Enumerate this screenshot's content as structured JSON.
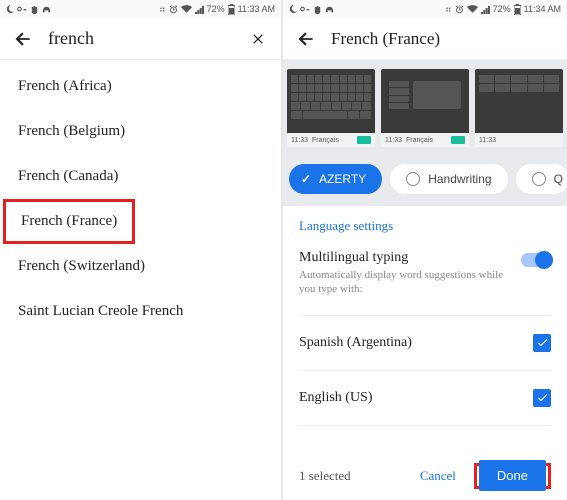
{
  "left": {
    "status": {
      "battery": "72%",
      "time": "11:33 AM"
    },
    "search_value": "french",
    "results": [
      "French (Africa)",
      "French (Belgium)",
      "French (Canada)",
      "French (France)",
      "French (Switzerland)",
      "Saint Lucian Creole French"
    ],
    "highlighted_index": 3
  },
  "right": {
    "status": {
      "battery": "72%",
      "time": "11:34 AM"
    },
    "title": "French (France)",
    "kb_captions": {
      "a": "Français",
      "b": "Français"
    },
    "layouts": {
      "selected": "AZERTY",
      "second": "Handwriting",
      "third": "Q"
    },
    "section_title": "Language settings",
    "multi": {
      "label": "Multilingual typing",
      "sub": "Automatically display word suggestions while you type with:",
      "on": true
    },
    "langs": [
      {
        "name": "Spanish (Argentina)",
        "checked": true
      },
      {
        "name": "English (US)",
        "checked": true
      }
    ],
    "footer": {
      "count": "1 selected",
      "cancel": "Cancel",
      "done": "Done"
    }
  }
}
